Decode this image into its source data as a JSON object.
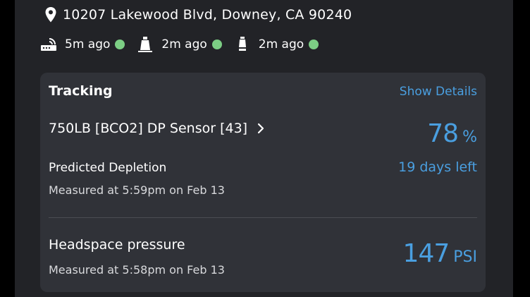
{
  "location": {
    "address": "10207 Lakewood Blvd, Downey, CA 90240",
    "icon": "map-pin-icon"
  },
  "status": [
    {
      "icon": "gateway-icon",
      "time": "5m ago",
      "dot_color": "#7cce84"
    },
    {
      "icon": "tank-sensor-icon",
      "time": "2m ago",
      "dot_color": "#7cce84"
    },
    {
      "icon": "cylinder-icon",
      "time": "2m ago",
      "dot_color": "#7cce84"
    }
  ],
  "tracking": {
    "title": "Tracking",
    "show_details": "Show Details",
    "sensor_name": "750LB [BCO2] DP Sensor [43]",
    "level_value": "78",
    "level_unit": "%",
    "predicted_label": "Predicted Depletion",
    "days_left": "19 days left",
    "level_measured": "Measured at 5:59pm on Feb 13",
    "headspace_label": "Headspace pressure",
    "pressure_value": "147",
    "pressure_unit": "PSI",
    "pressure_measured": "Measured at 5:58pm on Feb 13"
  },
  "colors": {
    "accent": "#4a9fe0",
    "status_ok": "#7cce84",
    "background": "#222327",
    "card": "#303238"
  }
}
